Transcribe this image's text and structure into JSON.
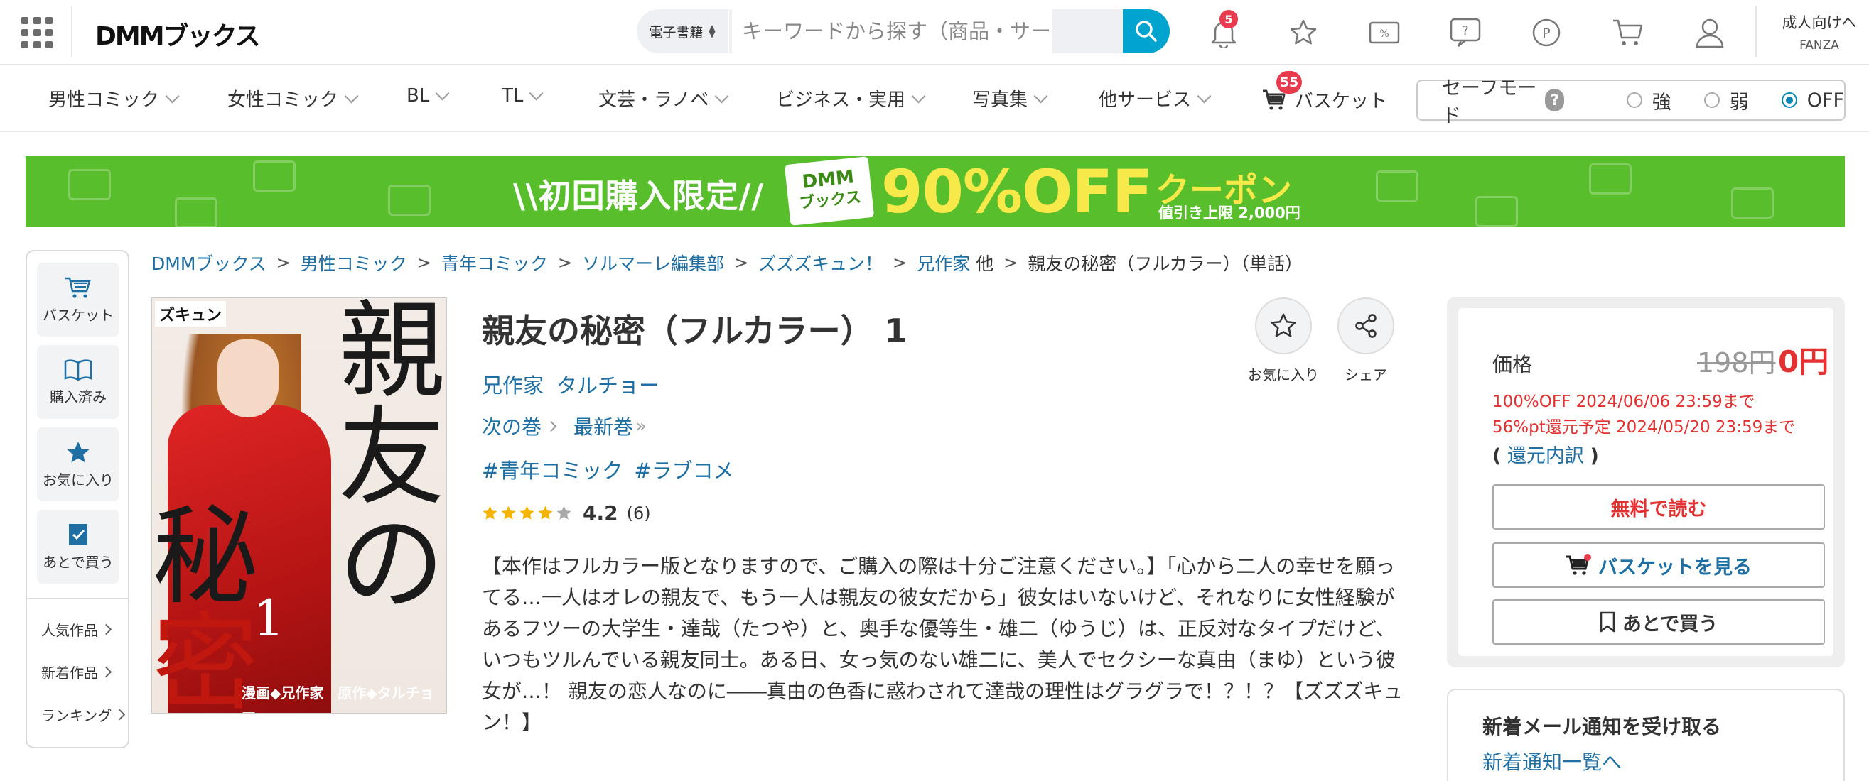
{
  "header": {
    "logo": "DMMブックス",
    "search": {
      "category": "電子書籍",
      "placeholder": "キーワードから探す（商品・サービス…"
    },
    "notifications_count": "5",
    "adult_link": {
      "line1": "成人向けへ",
      "line2": "FANZA"
    }
  },
  "nav": {
    "categories": [
      {
        "label": "男性コミック"
      },
      {
        "label": "女性コミック"
      },
      {
        "label": "BL"
      },
      {
        "label": "TL"
      },
      {
        "label": "文芸・ラノベ"
      },
      {
        "label": "ビジネス・実用"
      },
      {
        "label": "写真集"
      },
      {
        "label": "他サービス"
      }
    ],
    "basket_label": "バスケット",
    "basket_count": "55",
    "safe_mode": {
      "label": "セーフモード",
      "help": "?",
      "options": [
        {
          "label": "強",
          "selected": false
        },
        {
          "label": "弱",
          "selected": false
        },
        {
          "label": "OFF",
          "selected": true
        }
      ]
    }
  },
  "banner": {
    "left_text": "\\\\初回購入限定//",
    "logo_line1": "DMM",
    "logo_line2": "ブックス",
    "big_text": "90%OFF",
    "coupon": "クーポン",
    "limit": "値引き上限 2,000円"
  },
  "sidebar": {
    "buttons": [
      {
        "label": "バスケット",
        "icon": "cart-icon"
      },
      {
        "label": "購入済み",
        "icon": "book-icon"
      },
      {
        "label": "お気に入り",
        "icon": "star-icon"
      },
      {
        "label": "あとで買う",
        "icon": "bookmark-check-icon"
      }
    ],
    "links": [
      {
        "label": "人気作品"
      },
      {
        "label": "新着作品"
      },
      {
        "label": "ランキング"
      }
    ]
  },
  "breadcrumb": {
    "items": [
      "DMMブックス",
      "男性コミック",
      "青年コミック",
      "ソルマーレ編集部",
      "ズズズキュン！",
      "兄作家"
    ],
    "extra": "他",
    "current": "親友の秘密（フルカラー）（単話）"
  },
  "cover": {
    "publisher_mark": "ズキュン",
    "title_chars": [
      "親",
      "友",
      "の",
      "秘",
      "密"
    ],
    "volume": "1",
    "credits": "漫画◆兄作家　原作◆タルチョー"
  },
  "product": {
    "title": "親友の秘密（フルカラー） 1",
    "authors": [
      "兄作家",
      "タルチョー"
    ],
    "next_volume": "次の巻",
    "latest_volume": "最新巻",
    "tags": [
      "#青年コミック",
      "#ラブコメ"
    ],
    "rating": 4.2,
    "rating_text": "4.2",
    "review_count": "(6)",
    "description": "【本作はフルカラー版となりますので、ご購入の際は十分ご注意ください。】「心から二人の幸せを願ってる…一人はオレの親友で、もう一人は親友の彼女だから」彼女はいないけど、それなりに女性経験があるフツーの大学生・達哉（たつや）と、奥手な優等生・雄二（ゆうじ）は、正反対なタイプだけど、いつもツルんでいる親友同士。ある日、女っ気のない雄二に、美人でセクシーな真由（まゆ）という彼女が…！ 親友の恋人なのに――真由の色香に惑わされて達哉の理性はグラグラで！？！？【ズズズキュン！】",
    "favorite_label": "お気に入り",
    "share_label": "シェア"
  },
  "price": {
    "label": "価格",
    "original": "198円",
    "current": "0円",
    "discount_note": "100%OFF 2024/06/06 23:59まで",
    "point_note": "56%pt還元予定 2024/05/20 23:59まで",
    "return_prefix": "(",
    "return_link": "還元内訳",
    "return_suffix": ")",
    "free_read_button": "無料で読む",
    "view_basket_button": "バスケットを見る",
    "buy_later_button": "あとで買う"
  },
  "mail": {
    "title": "新着メール通知を受け取る",
    "link": "新着通知一覧へ"
  },
  "colors": {
    "link": "#1f6fa3",
    "accent_search": "#00a4cf",
    "price_red": "#e33030",
    "badge_red": "#e83b4e",
    "banner_green": "#58be2c",
    "banner_yellow": "#f7e94a"
  }
}
